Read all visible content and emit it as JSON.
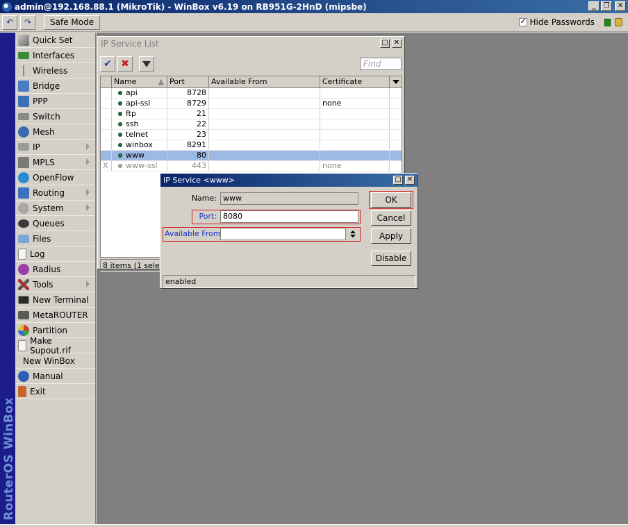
{
  "window": {
    "title": "admin@192.168.88.1 (MikroTik) - WinBox v6.19 on RB951G-2HnD (mipsbe)",
    "min": "_",
    "max": "❐",
    "close": "✕"
  },
  "toolbar": {
    "undo": "↶",
    "redo": "↷",
    "safe_mode": "Safe Mode",
    "hide_passwords_label": "Hide Passwords",
    "hide_passwords_checked": "✓"
  },
  "sidebar": {
    "brand": "RouterOS WinBox",
    "items": [
      {
        "label": "Quick Set"
      },
      {
        "label": "Interfaces"
      },
      {
        "label": "Wireless"
      },
      {
        "label": "Bridge"
      },
      {
        "label": "PPP"
      },
      {
        "label": "Switch"
      },
      {
        "label": "Mesh"
      },
      {
        "label": "IP"
      },
      {
        "label": "MPLS"
      },
      {
        "label": "OpenFlow"
      },
      {
        "label": "Routing"
      },
      {
        "label": "System"
      },
      {
        "label": "Queues"
      },
      {
        "label": "Files"
      },
      {
        "label": "Log"
      },
      {
        "label": "Radius"
      },
      {
        "label": "Tools"
      },
      {
        "label": "New Terminal"
      },
      {
        "label": "MetaROUTER"
      },
      {
        "label": "Partition"
      },
      {
        "label": "Make Supout.rif"
      },
      {
        "label": "New WinBox"
      },
      {
        "label": "Manual"
      },
      {
        "label": "Exit"
      }
    ]
  },
  "service_list": {
    "title": "IP Service List",
    "find_placeholder": "Find",
    "columns": [
      "Name",
      "Port",
      "Available From",
      "Certificate"
    ],
    "rows": [
      {
        "flag": "",
        "name": "api",
        "port": "8728",
        "available_from": "",
        "certificate": ""
      },
      {
        "flag": "",
        "name": "api-ssl",
        "port": "8729",
        "available_from": "",
        "certificate": "none"
      },
      {
        "flag": "",
        "name": "ftp",
        "port": "21",
        "available_from": "",
        "certificate": ""
      },
      {
        "flag": "",
        "name": "ssh",
        "port": "22",
        "available_from": "",
        "certificate": ""
      },
      {
        "flag": "",
        "name": "telnet",
        "port": "23",
        "available_from": "",
        "certificate": ""
      },
      {
        "flag": "",
        "name": "winbox",
        "port": "8291",
        "available_from": "",
        "certificate": ""
      },
      {
        "flag": "",
        "name": "www",
        "port": "80",
        "available_from": "",
        "certificate": ""
      },
      {
        "flag": "X",
        "name": "www-ssl",
        "port": "443",
        "available_from": "",
        "certificate": "none"
      }
    ],
    "status": "8 items (1 selected)"
  },
  "dialog": {
    "title": "IP Service <www>",
    "name_label": "Name:",
    "name_value": "www",
    "port_label": "Port:",
    "port_value": "8080",
    "available_from_label": "Available From:",
    "available_from_value": "",
    "buttons": {
      "ok": "OK",
      "cancel": "Cancel",
      "apply": "Apply",
      "disable": "Disable"
    },
    "status": "enabled"
  },
  "colors": {
    "highlight_border": "#d21e1e",
    "field_label_blue": "#1c34c8",
    "selected_row": "#9db9e5"
  }
}
